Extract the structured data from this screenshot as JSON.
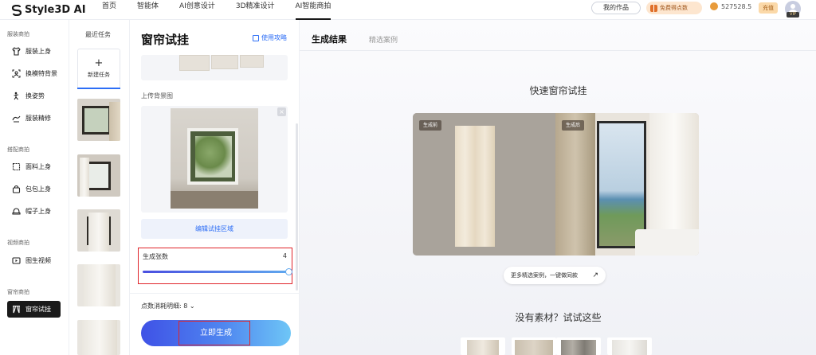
{
  "topbar": {
    "logo_text": "Style3D AI",
    "nav": [
      "首页",
      "智能体",
      "AI创意设计",
      "3D精准设计",
      "AI智能商拍"
    ],
    "active_nav_index": 4,
    "my_works_label": "我的作品",
    "free_points_label": "免费得点数",
    "balance": "527528.5",
    "recharge_label": "充值",
    "vip_label": "VIP"
  },
  "sidebar": {
    "sections": [
      {
        "title": "服装商拍",
        "items": [
          {
            "label": "服装上身",
            "icon": "tshirt-icon"
          },
          {
            "label": "换模特背景",
            "icon": "scan-person-icon"
          },
          {
            "label": "换姿势",
            "icon": "pose-icon"
          },
          {
            "label": "服装精修",
            "icon": "retouch-icon"
          }
        ]
      },
      {
        "title": "搭配商拍",
        "items": [
          {
            "label": "面料上身",
            "icon": "fabric-icon"
          },
          {
            "label": "包包上身",
            "icon": "bag-icon"
          },
          {
            "label": "帽子上身",
            "icon": "hat-icon"
          }
        ]
      },
      {
        "title": "视频商拍",
        "items": [
          {
            "label": "图生视频",
            "icon": "video-icon"
          }
        ]
      },
      {
        "title": "窗帘商拍",
        "items": [
          {
            "label": "窗帘试挂",
            "icon": "curtain-icon",
            "active": true
          }
        ]
      }
    ]
  },
  "tasks": {
    "title": "最近任务",
    "new_task_label": "新建任务",
    "new_task_plus": "+"
  },
  "panel": {
    "title": "窗帘试挂",
    "guide_label": "使用攻略",
    "upload_label": "上传背景图",
    "close_glyph": "×",
    "edit_area_label": "编辑试挂区域",
    "count_label": "生成张数",
    "count_value": "4",
    "count_fraction": 1.0,
    "cost_label": "点数消耗明细: 8",
    "cost_chevron": "⌄",
    "generate_label": "立即生成"
  },
  "main": {
    "tabs": [
      "生成结果",
      "精选案例"
    ],
    "quick_title": "快速窗帘试挂",
    "before_tag": "生成前",
    "after_tag": "生成后",
    "more_label": "更多精选案例，一键做同款",
    "more_arrow": "↗",
    "no_material_title": "没有素材？试试这些"
  },
  "colors": {
    "accent": "#2d6ef6",
    "highlight_border": "#e0242a",
    "active_sidebar_bg": "#1a1a1a"
  }
}
